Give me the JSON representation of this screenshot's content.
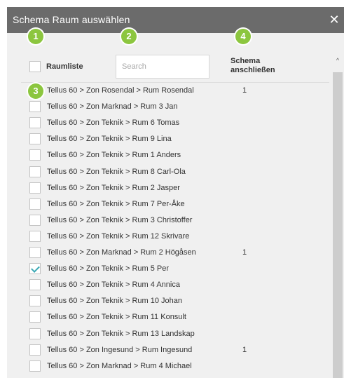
{
  "dialog": {
    "title": "Schema Raum auswählen",
    "close_glyph": "✕"
  },
  "header": {
    "room_list_label": "Raumliste",
    "search": {
      "value": "",
      "placeholder": "Search"
    },
    "schedule_label_line1": "Schema",
    "schedule_label_line2": "anschließen"
  },
  "callouts": [
    "1",
    "2",
    "3",
    "4"
  ],
  "rows": [
    {
      "label": "Tellus 60 > Zon Rosendal > Rum Rosendal",
      "count": "1",
      "checked": false
    },
    {
      "label": "Tellus 60 > Zon Marknad > Rum 3 Jan",
      "count": "",
      "checked": false
    },
    {
      "label": "Tellus 60 > Zon Teknik > Rum 6 Tomas",
      "count": "",
      "checked": false
    },
    {
      "label": "Tellus 60 > Zon Teknik > Rum 9 Lina",
      "count": "",
      "checked": false
    },
    {
      "label": "Tellus 60 > Zon Teknik > Rum 1 Anders",
      "count": "",
      "checked": false
    },
    {
      "label": "Tellus 60 > Zon Teknik > Rum 8 Carl-Ola",
      "count": "",
      "checked": false
    },
    {
      "label": "Tellus 60 > Zon Teknik > Rum 2 Jasper",
      "count": "",
      "checked": false
    },
    {
      "label": "Tellus 60 > Zon Teknik > Rum 7 Per-Åke",
      "count": "",
      "checked": false
    },
    {
      "label": "Tellus 60 > Zon Teknik > Rum 3 Christoffer",
      "count": "",
      "checked": false
    },
    {
      "label": "Tellus 60 > Zon Teknik > Rum 12 Skrivare",
      "count": "",
      "checked": false
    },
    {
      "label": "Tellus 60 > Zon Marknad > Rum 2 Högåsen",
      "count": "1",
      "checked": false
    },
    {
      "label": "Tellus 60 > Zon Teknik > Rum 5 Per",
      "count": "",
      "checked": true
    },
    {
      "label": "Tellus 60 > Zon Teknik > Rum 4 Annica",
      "count": "",
      "checked": false
    },
    {
      "label": "Tellus 60 > Zon Teknik > Rum 10 Johan",
      "count": "",
      "checked": false
    },
    {
      "label": "Tellus 60 > Zon Teknik > Rum 11 Konsult",
      "count": "",
      "checked": false
    },
    {
      "label": "Tellus 60 > Zon Teknik > Rum 13 Landskap",
      "count": "",
      "checked": false
    },
    {
      "label": "Tellus 60 > Zon Ingesund > Rum Ingesund",
      "count": "1",
      "checked": false
    },
    {
      "label": "Tellus 60 > Zon Marknad > Rum 4 Michael",
      "count": "",
      "checked": false
    }
  ],
  "scrollbar": {
    "up_glyph": "^"
  },
  "colors": {
    "titlebar": "#6b6b6b",
    "background": "#f0f0f0",
    "callout": "#8cc63f",
    "checkmark": "#3aa8b4"
  }
}
